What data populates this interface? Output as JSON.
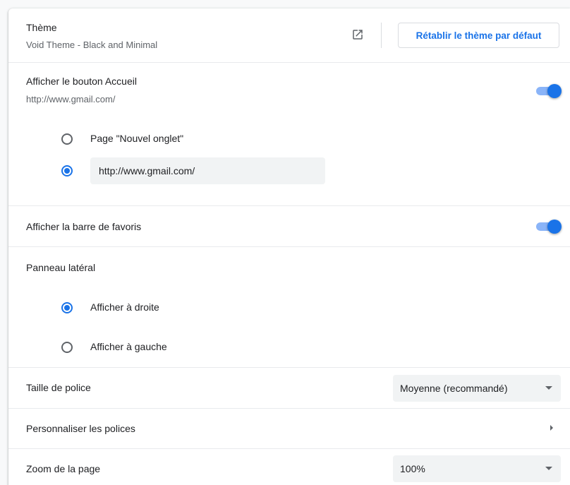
{
  "theme": {
    "label": "Thème",
    "value": "Void Theme - Black and Minimal",
    "open_icon": "open-in-new-icon",
    "reset_button": "Rétablir le thème par défaut"
  },
  "home_button": {
    "label": "Afficher le bouton Accueil",
    "url": "http://www.gmail.com/",
    "enabled": true,
    "options": [
      {
        "label": "Page \"Nouvel onglet\"",
        "selected": false
      },
      {
        "label": "",
        "selected": true
      }
    ],
    "custom_url_value": "http://www.gmail.com/"
  },
  "bookmarks_bar": {
    "label": "Afficher la barre de favoris",
    "enabled": true
  },
  "side_panel": {
    "label": "Panneau latéral",
    "options": [
      {
        "label": "Afficher à droite",
        "selected": true
      },
      {
        "label": "Afficher à gauche",
        "selected": false
      }
    ]
  },
  "font_size": {
    "label": "Taille de police",
    "selected": "Moyenne (recommandé)"
  },
  "customize_fonts": {
    "label": "Personnaliser les polices"
  },
  "page_zoom": {
    "label": "Zoom de la page",
    "selected": "100%"
  },
  "colors": {
    "accent": "#1a73e8",
    "toggle_track": "#8ab4f8",
    "separator": "#e8eaed",
    "secondary_text": "#5f6368"
  }
}
